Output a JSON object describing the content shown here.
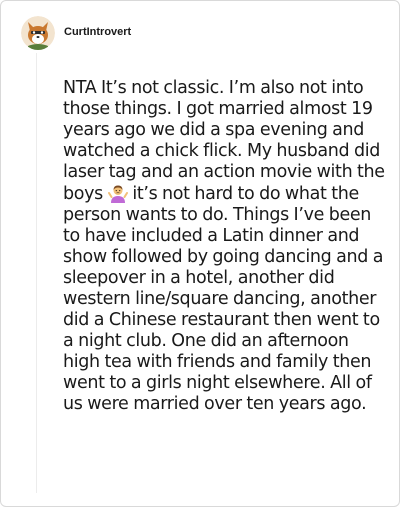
{
  "comment": {
    "author": "CurtIntrovert",
    "avatar_icon": "fox-avatar-icon",
    "text_part1": "NTA It’s not classic. I’m also not into those things. I got married almost 19 years ago we did a spa evening and watched a chick flick. My husband did laser tag and an action movie with the boys",
    "emoji_icon": "person-shrugging-emoji-icon",
    "text_part2": "it’s not hard to do what the person wants to do. Things I’ve been to have included a Latin dinner and show followed by going dancing and a sleepover in a hotel, another did western line/square dancing, another did a Chinese restaurant then went to a night club. One did an afternoon high tea with friends and family then went to a girls night elsewhere. All of us were married over ten years ago."
  },
  "colors": {
    "text": "#1a1a1a",
    "border": "#d9d9d9",
    "thread_line": "#ececec",
    "avatar_bg": "#f3e4cf",
    "avatar_fur": "#c9782f",
    "emoji_skin": "#f2c078",
    "emoji_shirt": "#c06ad6"
  }
}
